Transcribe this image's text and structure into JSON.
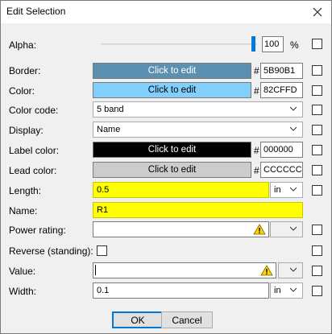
{
  "window": {
    "title": "Edit Selection"
  },
  "fields": {
    "alpha": {
      "label": "Alpha:",
      "value": "100",
      "unit": "%",
      "level_percent": 100
    },
    "border": {
      "label": "Border:",
      "button": "Click to edit",
      "hash": "#",
      "hex": "5B90B1",
      "swatch": "#5b90b1",
      "text_color": "#ffffff"
    },
    "color": {
      "label": "Color:",
      "button": "Click to edit",
      "hash": "#",
      "hex": "82CFFD",
      "swatch": "#82cffd",
      "text_color": "#000000"
    },
    "color_code": {
      "label": "Color code:",
      "value": "5 band"
    },
    "display": {
      "label": "Display:",
      "value": "Name"
    },
    "label_color": {
      "label": "Label color:",
      "button": "Click to edit",
      "hash": "#",
      "hex": "000000",
      "swatch": "#000000",
      "text_color": "#ffffff"
    },
    "lead_color": {
      "label": "Lead color:",
      "button": "Click to edit",
      "hash": "#",
      "hex": "CCCCCC",
      "swatch": "#cccccc",
      "text_color": "#000000"
    },
    "length": {
      "label": "Length:",
      "value": "0.5",
      "unit": "in"
    },
    "name": {
      "label": "Name:",
      "value": "R1"
    },
    "power_rating": {
      "label": "Power rating:",
      "value": ""
    },
    "reverse": {
      "label": "Reverse (standing):"
    },
    "value": {
      "label": "Value:",
      "value": ""
    },
    "width": {
      "label": "Width:",
      "value": "0.1",
      "unit": "in"
    }
  },
  "buttons": {
    "ok": "OK",
    "cancel": "Cancel"
  },
  "colors": {
    "highlight_yellow": "#ffff00",
    "accent": "#0078d7"
  },
  "icons": {
    "close": "close-icon",
    "chevron": "chevron-down-icon",
    "warning": "warning-icon"
  }
}
